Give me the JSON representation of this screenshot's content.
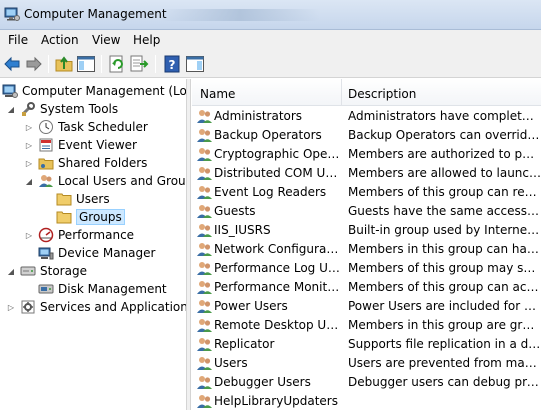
{
  "window": {
    "title": "Computer Management"
  },
  "menu": [
    "File",
    "Action",
    "View",
    "Help"
  ],
  "tree": [
    {
      "label": "Computer Management (Local",
      "indent": 0,
      "icon": "computer-management-icon",
      "expander": ""
    },
    {
      "label": "System Tools",
      "indent": 1,
      "icon": "system-tools-icon",
      "expander": "◢"
    },
    {
      "label": "Task Scheduler",
      "indent": 2,
      "icon": "clock-icon",
      "expander": "▷"
    },
    {
      "label": "Event Viewer",
      "indent": 2,
      "icon": "event-viewer-icon",
      "expander": "▷"
    },
    {
      "label": "Shared Folders",
      "indent": 2,
      "icon": "shared-folder-icon",
      "expander": "▷"
    },
    {
      "label": "Local Users and Groups",
      "indent": 2,
      "icon": "users-groups-icon",
      "expander": "◢"
    },
    {
      "label": "Users",
      "indent": 3,
      "icon": "folder-icon",
      "expander": ""
    },
    {
      "label": "Groups",
      "indent": 3,
      "icon": "folder-icon",
      "expander": "",
      "selected": true
    },
    {
      "label": "Performance",
      "indent": 2,
      "icon": "performance-icon",
      "expander": "▷"
    },
    {
      "label": "Device Manager",
      "indent": 2,
      "icon": "device-manager-icon",
      "expander": ""
    },
    {
      "label": "Storage",
      "indent": 1,
      "icon": "storage-icon",
      "expander": "◢"
    },
    {
      "label": "Disk Management",
      "indent": 2,
      "icon": "disk-management-icon",
      "expander": ""
    },
    {
      "label": "Services and Applications",
      "indent": 1,
      "icon": "services-icon",
      "expander": "▷"
    }
  ],
  "columns": {
    "name": "Name",
    "description": "Description"
  },
  "groups": [
    {
      "name": "Administrators",
      "description": "Administrators have complete an..."
    },
    {
      "name": "Backup Operators",
      "description": "Backup Operators can override se..."
    },
    {
      "name": "Cryptographic Operat...",
      "description": "Members are authorized to perfor..."
    },
    {
      "name": "Distributed COM Users",
      "description": "Members are allowed to launch, a..."
    },
    {
      "name": "Event Log Readers",
      "description": "Members of this group can read e..."
    },
    {
      "name": "Guests",
      "description": "Guests have the same access as m..."
    },
    {
      "name": "IIS_IUSRS",
      "description": "Built-in group used by Internet Inf..."
    },
    {
      "name": "Network Configuratio...",
      "description": "Members in this group can have s..."
    },
    {
      "name": "Performance Log Users",
      "description": "Members of this group may sche..."
    },
    {
      "name": "Performance Monitor ...",
      "description": "Members of this group can acces..."
    },
    {
      "name": "Power Users",
      "description": "Power Users are included for back..."
    },
    {
      "name": "Remote Desktop Users",
      "description": "Members in this group are grante..."
    },
    {
      "name": "Replicator",
      "description": "Supports file replication in a dom..."
    },
    {
      "name": "Users",
      "description": "Users are prevented from making ..."
    },
    {
      "name": "Debugger Users",
      "description": "Debugger users can debug proces..."
    },
    {
      "name": "HelpLibraryUpdaters",
      "description": ""
    }
  ],
  "toolbar": [
    "back-icon",
    "forward-icon",
    "up-folder-icon",
    "show-hide-tree-icon",
    "refresh-icon",
    "export-list-icon",
    "help-icon",
    "show-hide-action-pane-icon"
  ]
}
